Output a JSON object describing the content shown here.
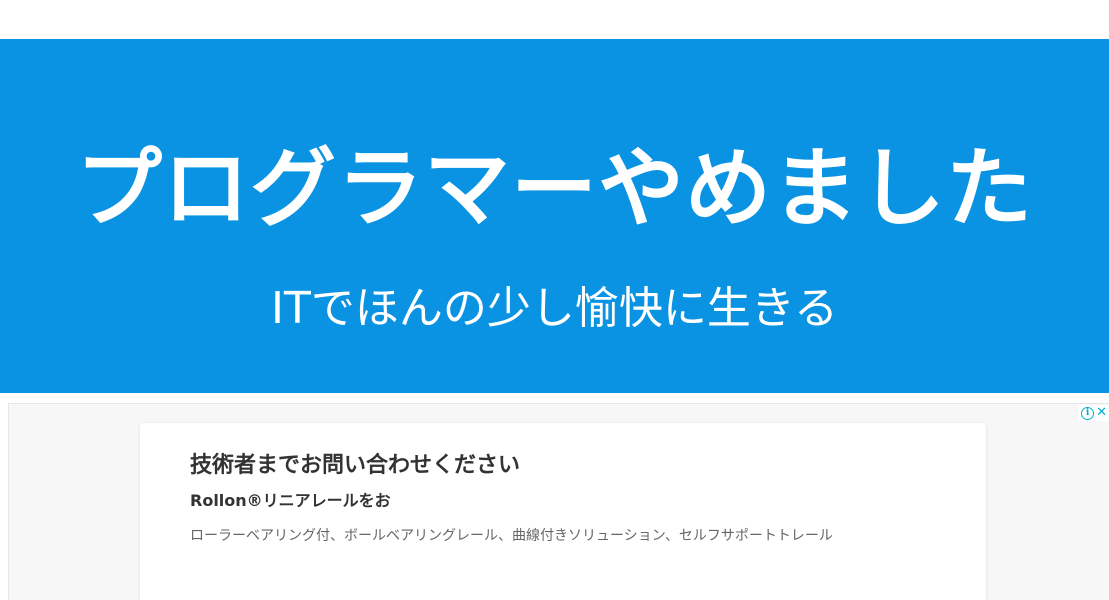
{
  "header": {
    "title": "プログラマーやめました",
    "subtitle": "ITでほんの少し愉快に生きる"
  },
  "ad": {
    "choices_icon": "info-icon",
    "close_icon": "close-icon",
    "headline": "技術者までお問い合わせください",
    "subheadline": "Rollon®リニアレールをお",
    "body": "ローラーベアリング付、ボールベアリングレール、曲線付きソリューション、セルフサポートトレール"
  },
  "colors": {
    "banner_bg": "#0a93e3",
    "banner_text": "#ffffff",
    "ad_bg": "#f7f7f7",
    "ad_icon": "#00aecd"
  }
}
